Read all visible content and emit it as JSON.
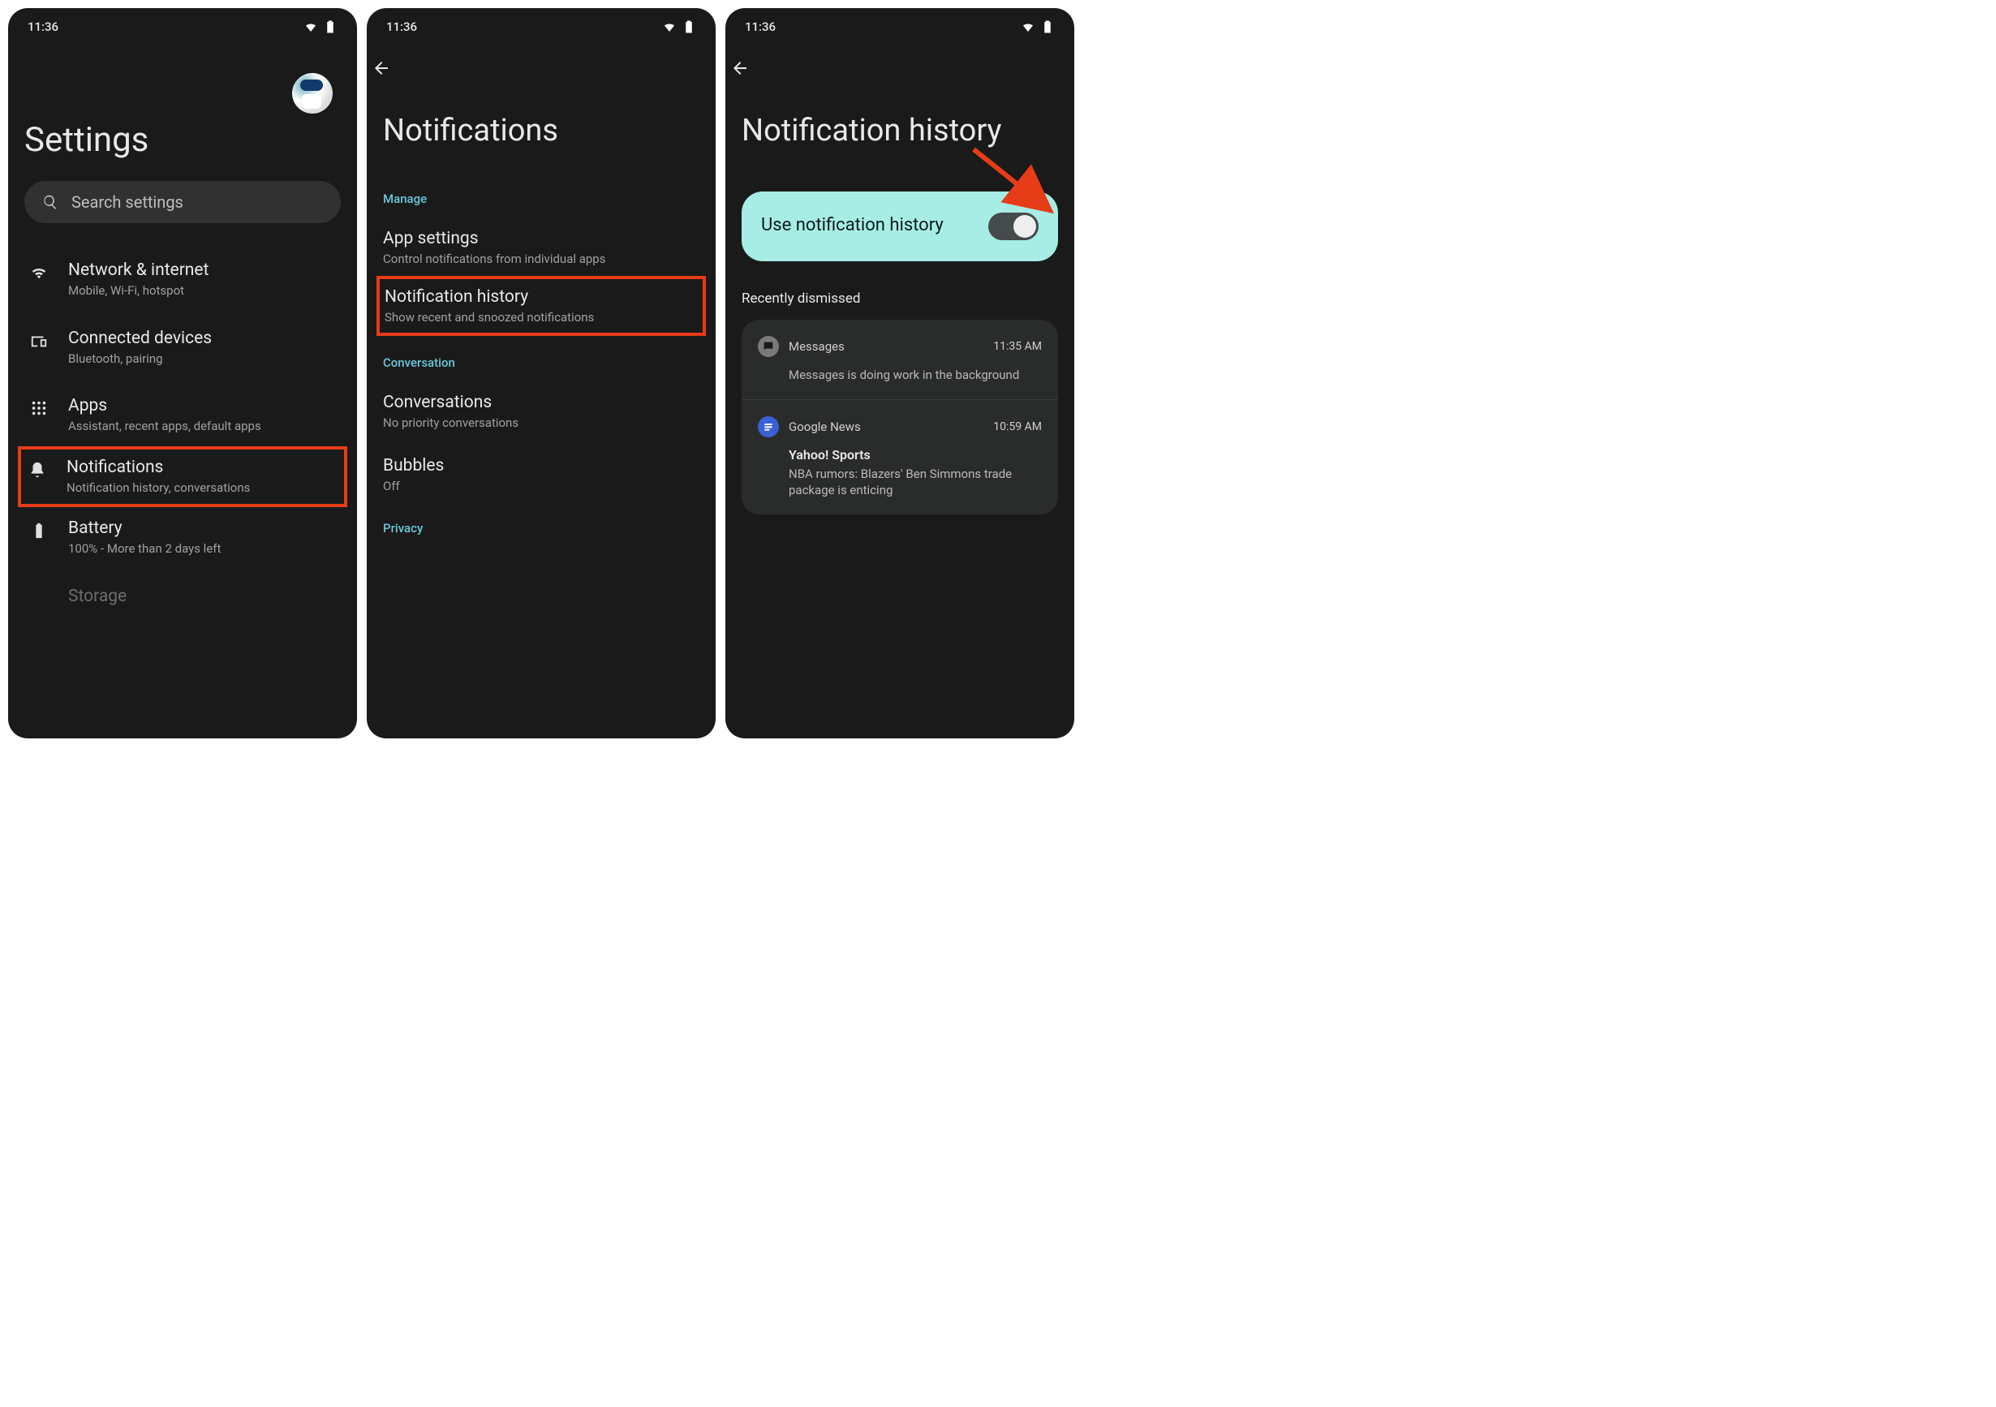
{
  "status": {
    "time": "11:36"
  },
  "screen1": {
    "title": "Settings",
    "search_placeholder": "Search settings",
    "items": [
      {
        "title": "Network & internet",
        "sub": "Mobile, Wi-Fi, hotspot"
      },
      {
        "title": "Connected devices",
        "sub": "Bluetooth, pairing"
      },
      {
        "title": "Apps",
        "sub": "Assistant, recent apps, default apps"
      },
      {
        "title": "Notifications",
        "sub": "Notification history, conversations"
      },
      {
        "title": "Battery",
        "sub": "100% - More than 2 days left"
      },
      {
        "title": "Storage",
        "sub": ""
      }
    ]
  },
  "screen2": {
    "title": "Notifications",
    "sections": {
      "manage": "Manage",
      "conversation": "Conversation",
      "privacy": "Privacy"
    },
    "items": [
      {
        "title": "App settings",
        "sub": "Control notifications from individual apps"
      },
      {
        "title": "Notification history",
        "sub": "Show recent and snoozed notifications"
      },
      {
        "title": "Conversations",
        "sub": "No priority conversations"
      },
      {
        "title": "Bubbles",
        "sub": "Off"
      }
    ]
  },
  "screen3": {
    "title": "Notification history",
    "toggle_label": "Use notification history",
    "dismissed_header": "Recently dismissed",
    "notifications": [
      {
        "app": "Messages",
        "time": "11:35 AM",
        "title": "",
        "text": "Messages is doing work in the background",
        "icon_bg": "#7a7a7a"
      },
      {
        "app": "Google News",
        "time": "10:59 AM",
        "title": "Yahoo! Sports",
        "text": "NBA rumors: Blazers' Ben Simmons trade package is enticing",
        "icon_bg": "#3b5fd6"
      }
    ]
  }
}
